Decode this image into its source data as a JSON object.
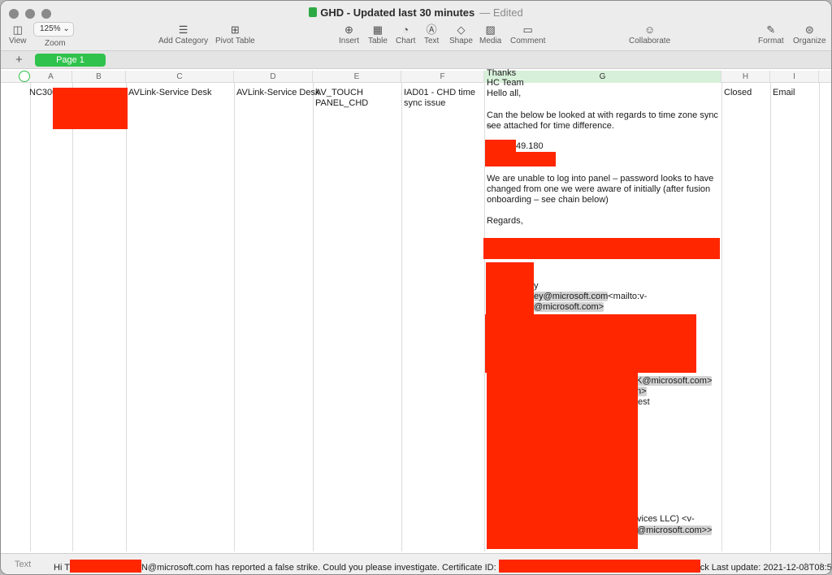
{
  "window": {
    "title": "GHD - Updated last 30 minutes",
    "status": "Edited"
  },
  "toolbar": {
    "view": "View",
    "zoom_value": "125% ⌄",
    "zoom": "Zoom",
    "add_category": "Add Category",
    "pivot_table": "Pivot Table",
    "insert": "Insert",
    "table": "Table",
    "chart": "Chart",
    "text": "Text",
    "shape": "Shape",
    "media": "Media",
    "comment": "Comment",
    "collaborate": "Collaborate",
    "format": "Format",
    "organize": "Organize"
  },
  "sheets": {
    "add": "+",
    "active": "Page 1"
  },
  "columns": [
    "A",
    "B",
    "C",
    "D",
    "E",
    "F",
    "G",
    "H",
    "I"
  ],
  "row": {
    "a": "NC300",
    "c": "AVLink-Service Desk",
    "d": "AVLink-Service Desk",
    "e1": "AV_TOUCH",
    "e2": "PANEL_CHD",
    "f1": "IAD01 - CHD time",
    "f2": "sync issue",
    "h": "Closed",
    "i": "Email"
  },
  "g_cell": {
    "prev1": "Thanks",
    "prev2": "HC Team",
    "greeting": "Hello all,",
    "p1a": "Can the below be looked at with regards to time zone sync –",
    "p1b": "see attached for time difference.",
    "ip": "49.180",
    "p2a": "We are unable to log into panel – password looks to have",
    "p2b": "changed from one we were aware of initially (after fusion",
    "p2c": "onboarding – see chain below)",
    "regards": "Regards,",
    "frag1": "y",
    "frag2a": "ey@microsoft.com",
    "frag2b": "<mailto:v-",
    "frag3": "@microsoft.com>",
    "frag4": "K@microsoft.com>",
    "frag5": "n>",
    "frag6": "est",
    "frag7a": "vices LLC) <v-",
    "frag8": "@microsoft.com>>"
  },
  "statusbar": {
    "kind": "Text",
    "hi": "Hi T",
    "msg": "N@microsoft.com has reported a false strike. Could you please investigate.  Certificate ID: ",
    "tail": "ck Last update: 2021-12-08T08:5",
    "prev": "‹",
    "next": "›"
  }
}
